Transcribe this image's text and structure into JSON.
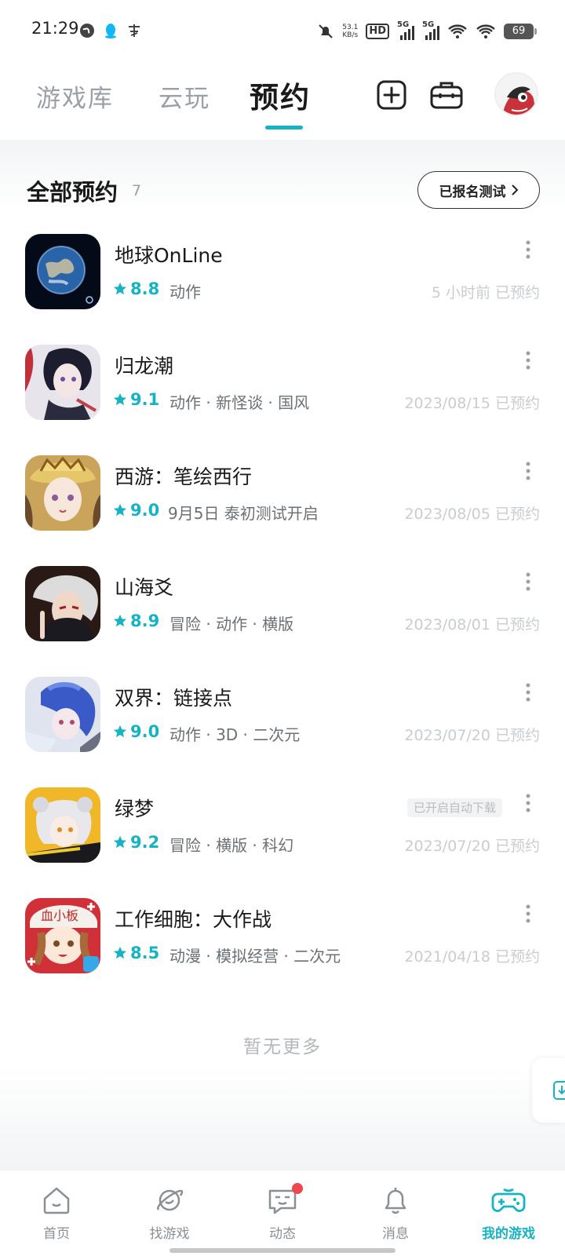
{
  "status_bar": {
    "time": "21:29",
    "net_speed_value": "53.1",
    "net_speed_unit": "KB/s",
    "hd_label": "HD",
    "signal_1_label": "5G",
    "signal_2_label": "5G",
    "battery": "69"
  },
  "header": {
    "tabs": [
      {
        "label": "游戏库"
      },
      {
        "label": "云玩"
      },
      {
        "label": "预约"
      }
    ],
    "active_tab": "预约",
    "add_icon": "plus-square-icon",
    "toolbox_icon": "toolbox-icon"
  },
  "section": {
    "title": "全部预约",
    "count": "7",
    "signup_button": "已报名测试"
  },
  "games": [
    {
      "name": "地球OnLine",
      "rating": "8.8",
      "tags": "动作",
      "date": "5 小时前 已预约",
      "auto_download": ""
    },
    {
      "name": "归龙潮",
      "rating": "9.1",
      "tags": "动作 · 新怪谈 · 国风",
      "date": "2023/08/15 已预约",
      "auto_download": ""
    },
    {
      "name": "西游：笔绘西行",
      "rating": "9.0",
      "tags": "9月5日 泰初测试开启",
      "date": "2023/08/05 已预约",
      "auto_download": ""
    },
    {
      "name": "山海爻",
      "rating": "8.9",
      "tags": "冒险 · 动作 · 横版",
      "date": "2023/08/01 已预约",
      "auto_download": ""
    },
    {
      "name": "双界：链接点",
      "rating": "9.0",
      "tags": "动作 · 3D · 二次元",
      "date": "2023/07/20 已预约",
      "auto_download": ""
    },
    {
      "name": "绿梦",
      "rating": "9.2",
      "tags": "冒险 · 横版 · 科幻",
      "date": "2023/07/20 已预约",
      "auto_download": "已开启自动下载"
    },
    {
      "name": "工作细胞：大作战",
      "rating": "8.5",
      "tags": "动漫 · 模拟经营 · 二次元",
      "date": "2021/04/18 已预约",
      "auto_download": ""
    }
  ],
  "footer_text": "暂无更多",
  "bottom_nav": [
    {
      "label": "首页",
      "icon": "home-icon"
    },
    {
      "label": "找游戏",
      "icon": "planet-icon"
    },
    {
      "label": "动态",
      "icon": "chat-icon",
      "has_dot": true
    },
    {
      "label": "消息",
      "icon": "bell-icon"
    },
    {
      "label": "我的游戏",
      "icon": "gamepad-icon",
      "active": true
    }
  ],
  "colors": {
    "accent": "#16b3c4",
    "notification_dot": "#f0454f"
  }
}
